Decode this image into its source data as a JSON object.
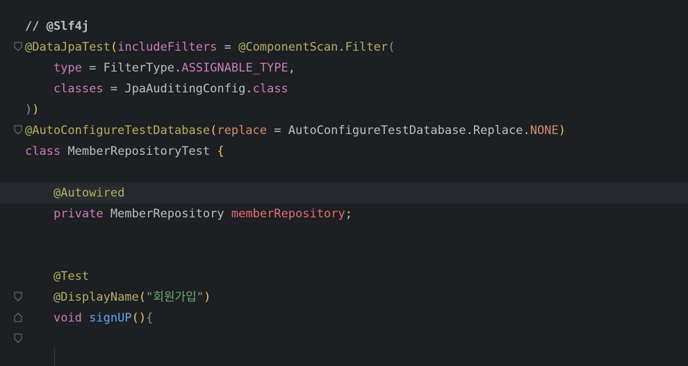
{
  "colors": {
    "background": "#1e1f22",
    "annotation": "#b3ae60",
    "keyword": "#cf8e6d",
    "field": "#c77dbb",
    "string": "#6aab73",
    "method": "#56a8f5",
    "variable": "#e06c75"
  },
  "lines": {
    "l1": {
      "comment": "// @Slf4j"
    },
    "l2": {
      "anno": "@DataJpaTest",
      "open": "(",
      "param": "includeFilters",
      "eq": " = ",
      "anno2": "@ComponentScan",
      "dot": ".",
      "cls": "Filter",
      "paren": "("
    },
    "l3": {
      "indent": "    ",
      "param": "type",
      "eq": " = ",
      "cls": "FilterType",
      "dot": ".",
      "field": "ASSIGNABLE_TYPE",
      "comma": ","
    },
    "l4": {
      "indent": "    ",
      "param": "classes",
      "eq": " = ",
      "cls": "JpaAuditingConfig",
      "dot": ".",
      "kw": "class"
    },
    "l5": {
      "close1": ")",
      "close2": ")"
    },
    "l6": {
      "anno": "@AutoConfigureTestDatabase",
      "open": "(",
      "param": "replace",
      "eq": " = ",
      "cls": "AutoConfigureTestDatabase",
      "dot1": ".",
      "cls2": "Replace",
      "dot2": ".",
      "field": "NONE",
      "close": ")"
    },
    "l7": {
      "kw": "class",
      "sp": " ",
      "cls": "MemberRepositoryTest",
      "brace": " {"
    },
    "l10": {
      "indent": "    ",
      "anno": "@Autowired"
    },
    "l11": {
      "indent": "    ",
      "kw": "private",
      "sp": " ",
      "type": "MemberRepository",
      "sp2": " ",
      "var": "memberRepository",
      "semi": ";"
    },
    "l14": {
      "indent": "    ",
      "anno": "@Test"
    },
    "l15": {
      "indent": "    ",
      "anno": "@DisplayName",
      "open": "(",
      "str": "\"회원가입\"",
      "close": ")"
    },
    "l16": {
      "indent": "    ",
      "kw": "void",
      "sp": " ",
      "method": "signUP",
      "parens": "()",
      "brace": "{"
    }
  },
  "gutter": {
    "fold_icons": [
      "fold-open-icon",
      "fold-open-icon",
      "fold-open-icon",
      "fold-end-icon",
      "fold-open-icon"
    ]
  }
}
